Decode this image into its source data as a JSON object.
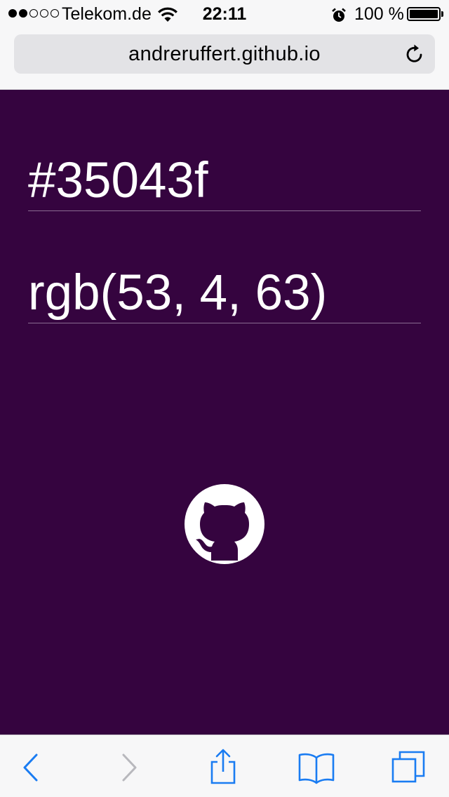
{
  "status_bar": {
    "carrier": "Telekom.de",
    "time": "22:11",
    "battery_percent": "100 %",
    "signal_bars_filled": 2,
    "signal_bars_total": 5
  },
  "browser": {
    "address": "andreruffert.github.io"
  },
  "page": {
    "background_color": "#35043f",
    "hex_value": "#35043f",
    "rgb_value": "rgb(53, 4, 63)"
  },
  "toolbar": {
    "icons": [
      "back-icon",
      "forward-icon",
      "share-icon",
      "bookmarks-icon",
      "tabs-icon"
    ]
  },
  "colors": {
    "ios_blue": "#1a7cf2",
    "disabled_gray": "#b8b8bd",
    "text_white": "#ffffff"
  }
}
